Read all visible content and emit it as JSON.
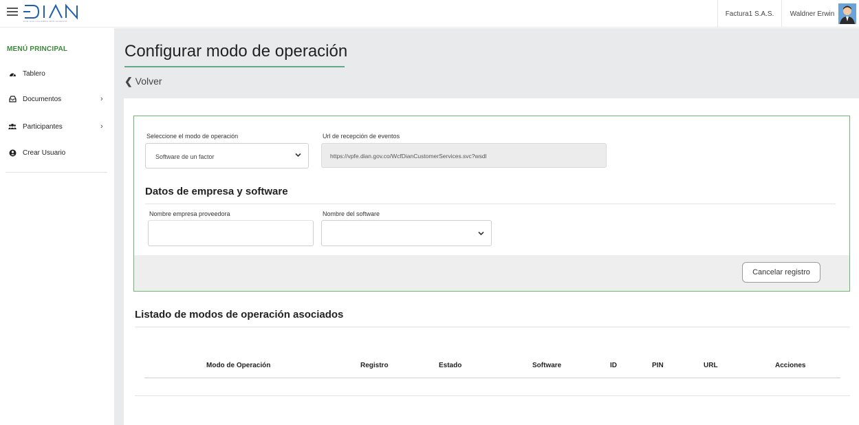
{
  "header": {
    "logo_text": "DIAN",
    "logo_tagline": "POR UNA COLOMBIA MÁS HONESTA",
    "company": "Factura1 S.A.S.",
    "user": "Waldner Erwin"
  },
  "sidebar": {
    "title": "MENÚ PRINCIPAL",
    "items": [
      {
        "label": "Tablero",
        "icon": "dashboard-icon"
      },
      {
        "label": "Documentos",
        "icon": "inbox-icon"
      },
      {
        "label": "Participantes",
        "icon": "users-icon"
      },
      {
        "label": "Crear Usuario",
        "icon": "user-circle-icon"
      }
    ]
  },
  "page": {
    "title": "Configurar modo de operación",
    "back_label": "Volver"
  },
  "form": {
    "mode_label": "Seleccione el modo de operación",
    "mode_value": "Software de un factor",
    "url_label": "Url de recepción de eventos",
    "url_value": "https://vpfe.dian.gov.co/WcfDianCustomerServices.svc?wsdl",
    "section_title": "Datos de empresa y software",
    "provider_label": "Nombre empresa proveedora",
    "provider_value": "",
    "software_label": "Nombre del software",
    "software_value": "",
    "cancel_label": "Cancelar registro"
  },
  "list": {
    "title": "Listado de modos de operación asociados",
    "columns": [
      "Modo de Operación",
      "Registro",
      "Estado",
      "Software",
      "ID",
      "PIN",
      "URL",
      "Acciones"
    ],
    "rows": []
  },
  "colors": {
    "accent_green": "#3a8a3a",
    "form_border": "#6fb36f",
    "title_underline": "#5fa88a",
    "logo_blue": "#1f5fae"
  }
}
